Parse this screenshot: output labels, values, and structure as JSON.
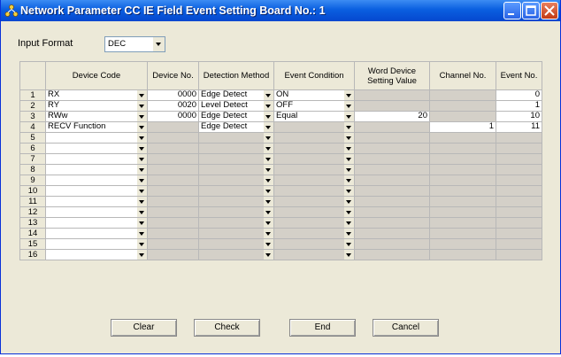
{
  "window": {
    "title": "Network Parameter CC IE Field Event Setting Board No.: 1"
  },
  "input_format": {
    "label": "Input Format",
    "value": "DEC"
  },
  "table": {
    "headers": [
      "Device Code",
      "Device No.",
      "Detection Method",
      "Event Condition",
      "Word Device Setting Value",
      "Channel No.",
      "Event No."
    ],
    "rows": [
      {
        "num": "1",
        "device_code": "RX",
        "device_no": "0000",
        "detection": "Edge Detect",
        "condition": "ON",
        "word_value": "",
        "channel": "",
        "event_no": "0"
      },
      {
        "num": "2",
        "device_code": "RY",
        "device_no": "0020",
        "detection": "Level Detect",
        "condition": "OFF",
        "word_value": "",
        "channel": "",
        "event_no": "1"
      },
      {
        "num": "3",
        "device_code": "RWw",
        "device_no": "0000",
        "detection": "Edge Detect",
        "condition": "Equal",
        "word_value": "20",
        "channel": "",
        "event_no": "10"
      },
      {
        "num": "4",
        "device_code": "RECV Function",
        "device_no": "",
        "detection": "Edge Detect",
        "condition": "",
        "word_value": "",
        "channel": "1",
        "event_no": "11"
      },
      {
        "num": "5"
      },
      {
        "num": "6"
      },
      {
        "num": "7"
      },
      {
        "num": "8"
      },
      {
        "num": "9"
      },
      {
        "num": "10"
      },
      {
        "num": "11"
      },
      {
        "num": "12"
      },
      {
        "num": "13"
      },
      {
        "num": "14"
      },
      {
        "num": "15"
      },
      {
        "num": "16"
      }
    ]
  },
  "buttons": {
    "clear": "Clear",
    "check": "Check",
    "end": "End",
    "cancel": "Cancel"
  }
}
